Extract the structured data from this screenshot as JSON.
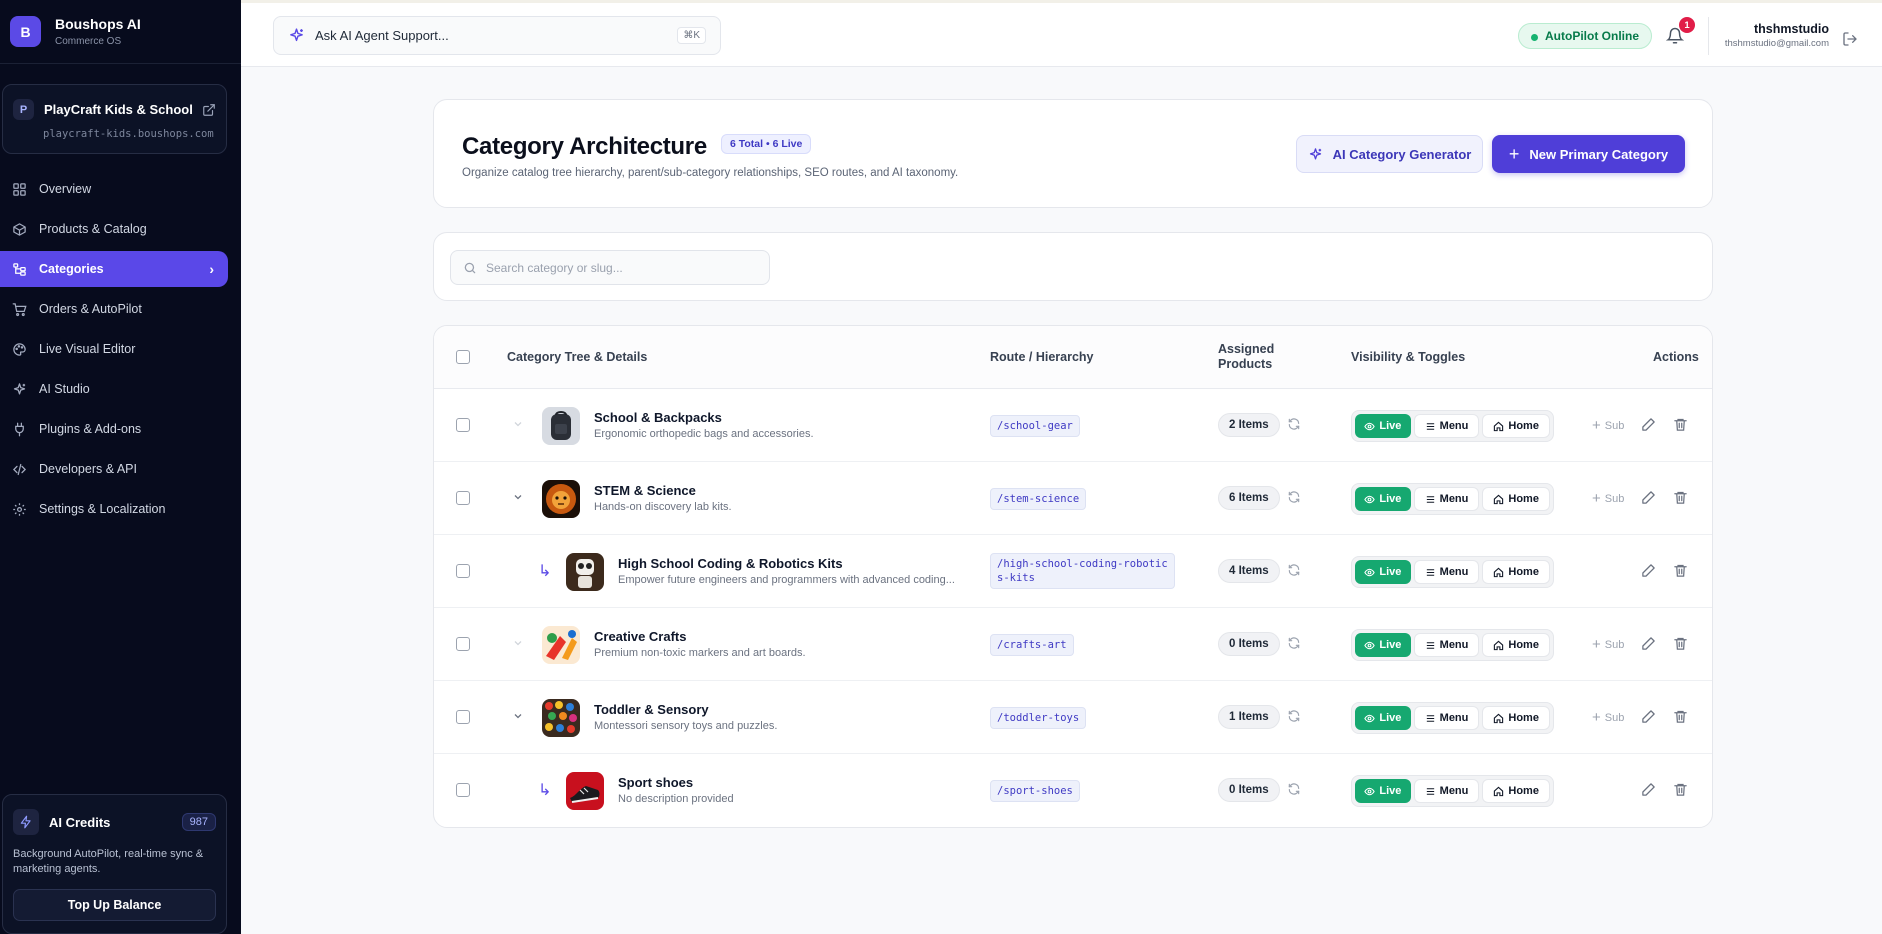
{
  "brand": {
    "logo": "B",
    "name": "Boushops AI",
    "sub": "Commerce OS"
  },
  "store": {
    "badge": "P",
    "name": "PlayCraft Kids & School",
    "url": "playcraft-kids.boushops.com",
    "icon": "external-link-icon"
  },
  "nav": [
    {
      "label": "Overview",
      "icon": "grid-icon"
    },
    {
      "label": "Products & Catalog",
      "icon": "box-icon"
    },
    {
      "label": "Categories",
      "icon": "tree-icon",
      "active": true
    },
    {
      "label": "Orders & AutoPilot",
      "icon": "cart-icon"
    },
    {
      "label": "Live Visual Editor",
      "icon": "palette-icon"
    },
    {
      "label": "AI Studio",
      "icon": "sparkle-icon"
    },
    {
      "label": "Plugins & Add-ons",
      "icon": "plug-icon"
    },
    {
      "label": "Developers & API",
      "icon": "code-icon"
    },
    {
      "label": "Settings & Localization",
      "icon": "gear-icon"
    }
  ],
  "credits": {
    "title": "AI Credits",
    "count": "987",
    "desc": "Background AutoPilot, real-time sync & marketing agents.",
    "button": "Top Up Balance"
  },
  "topbar": {
    "ask_label": "Ask AI Agent Support...",
    "kbd": "⌘K",
    "status": "AutoPilot Online",
    "notifications": "1",
    "user_name": "thshmstudio",
    "user_email": "thshmstudio@gmail.com"
  },
  "header": {
    "title": "Category Architecture",
    "badge": "6 Total • 6 Live",
    "desc": "Organize catalog tree hierarchy, parent/sub-category relationships, SEO routes, and AI taxonomy.",
    "ai_button": "AI Category Generator",
    "new_button": "New Primary Category"
  },
  "search": {
    "placeholder": "Search category or slug..."
  },
  "table": {
    "headers": {
      "tree": "Category Tree & Details",
      "route": "Route / Hierarchy",
      "assigned": "Assigned Products",
      "visibility": "Visibility & Toggles",
      "actions": "Actions"
    },
    "toggle_labels": {
      "live": "Live",
      "menu": "Menu",
      "home": "Home",
      "sub": "Sub"
    },
    "rows": [
      {
        "name": "School & Backpacks",
        "desc": "Ergonomic orthopedic bags and accessories.",
        "route": "/school-gear",
        "items": "2 Items",
        "level": 0,
        "expand": "faint",
        "thumb": "backpack"
      },
      {
        "name": "STEM & Science",
        "desc": "Hands-on discovery lab kits.",
        "route": "/stem-science",
        "items": "6 Items",
        "level": 0,
        "expand": "open",
        "thumb": "lion"
      },
      {
        "name": "High School Coding & Robotics Kits",
        "desc": "Empower future engineers and programmers with advanced coding...",
        "route": "/high-school-coding-robotics-kits",
        "items": "4 Items",
        "level": 1,
        "thumb": "robot"
      },
      {
        "name": "Creative Crafts",
        "desc": "Premium non-toxic markers and art boards.",
        "route": "/crafts-art",
        "items": "0 Items",
        "level": 0,
        "expand": "faint",
        "thumb": "paint"
      },
      {
        "name": "Toddler & Sensory",
        "desc": "Montessori sensory toys and puzzles.",
        "route": "/toddler-toys",
        "items": "1 Items",
        "level": 0,
        "expand": "open",
        "thumb": "beads"
      },
      {
        "name": "Sport shoes",
        "desc": "No description provided",
        "route": "/sport-shoes",
        "items": "0 Items",
        "level": 1,
        "thumb": "shoe"
      }
    ]
  },
  "colors": {
    "accent": "#5a48e8",
    "live": "#16a870",
    "sidebar": "#070b1d"
  }
}
